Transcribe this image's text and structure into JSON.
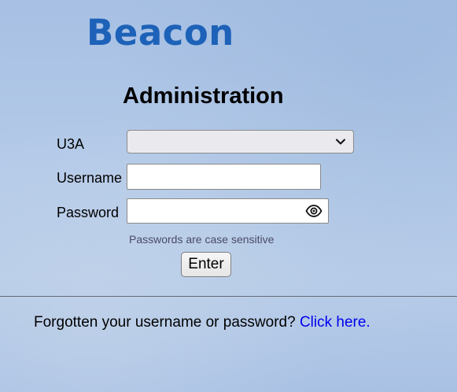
{
  "brand": {
    "logo_text": "Beacon",
    "logo_color": "#1d62b8"
  },
  "page": {
    "heading": "Administration"
  },
  "form": {
    "u3a_label": "U3A",
    "u3a_selected": "",
    "username_label": "Username",
    "username_value": "",
    "password_label": "Password",
    "password_value": "",
    "password_toggle_icon": "eye-icon",
    "hint": "Passwords are case sensitive",
    "submit_label": "Enter"
  },
  "footer": {
    "forgot_text": "Forgotten your username or password?",
    "link_text": "Click here.",
    "link_color": "#0000ee"
  }
}
